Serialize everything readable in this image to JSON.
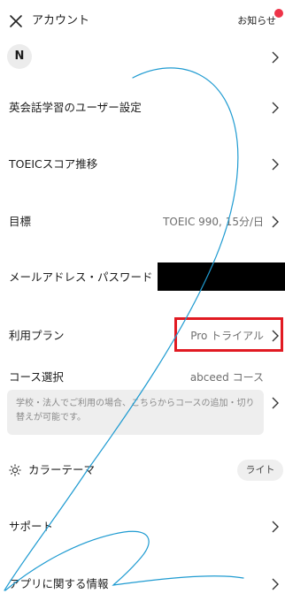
{
  "header": {
    "title": "アカウント",
    "news_label": "お知らせ",
    "news_dot_color": "#ee3348"
  },
  "profile": {
    "avatar_initial": "N"
  },
  "rows": {
    "settings": {
      "label": "英会話学習のユーザー設定"
    },
    "toeic_score": {
      "label": "TOEICスコア推移"
    },
    "goal": {
      "label": "目標",
      "value": "TOEIC 990, 15分/日"
    },
    "email": {
      "label": "メールアドレス・パスワード"
    },
    "plan": {
      "label": "利用プラン",
      "value": "Pro トライアル"
    },
    "course": {
      "label": "コース選択",
      "value": "abceed コース",
      "description": "学校・法人でご利用の場合、こちらからコースの追加・切り替えが可能です。"
    },
    "theme": {
      "label": "カラーテーマ",
      "value": "ライト"
    },
    "support": {
      "label": "サポート"
    },
    "app_info": {
      "label": "アプリに関する情報"
    }
  },
  "colors": {
    "highlight": "#e11a22",
    "annotation_stroke": "#1f9bd1"
  }
}
